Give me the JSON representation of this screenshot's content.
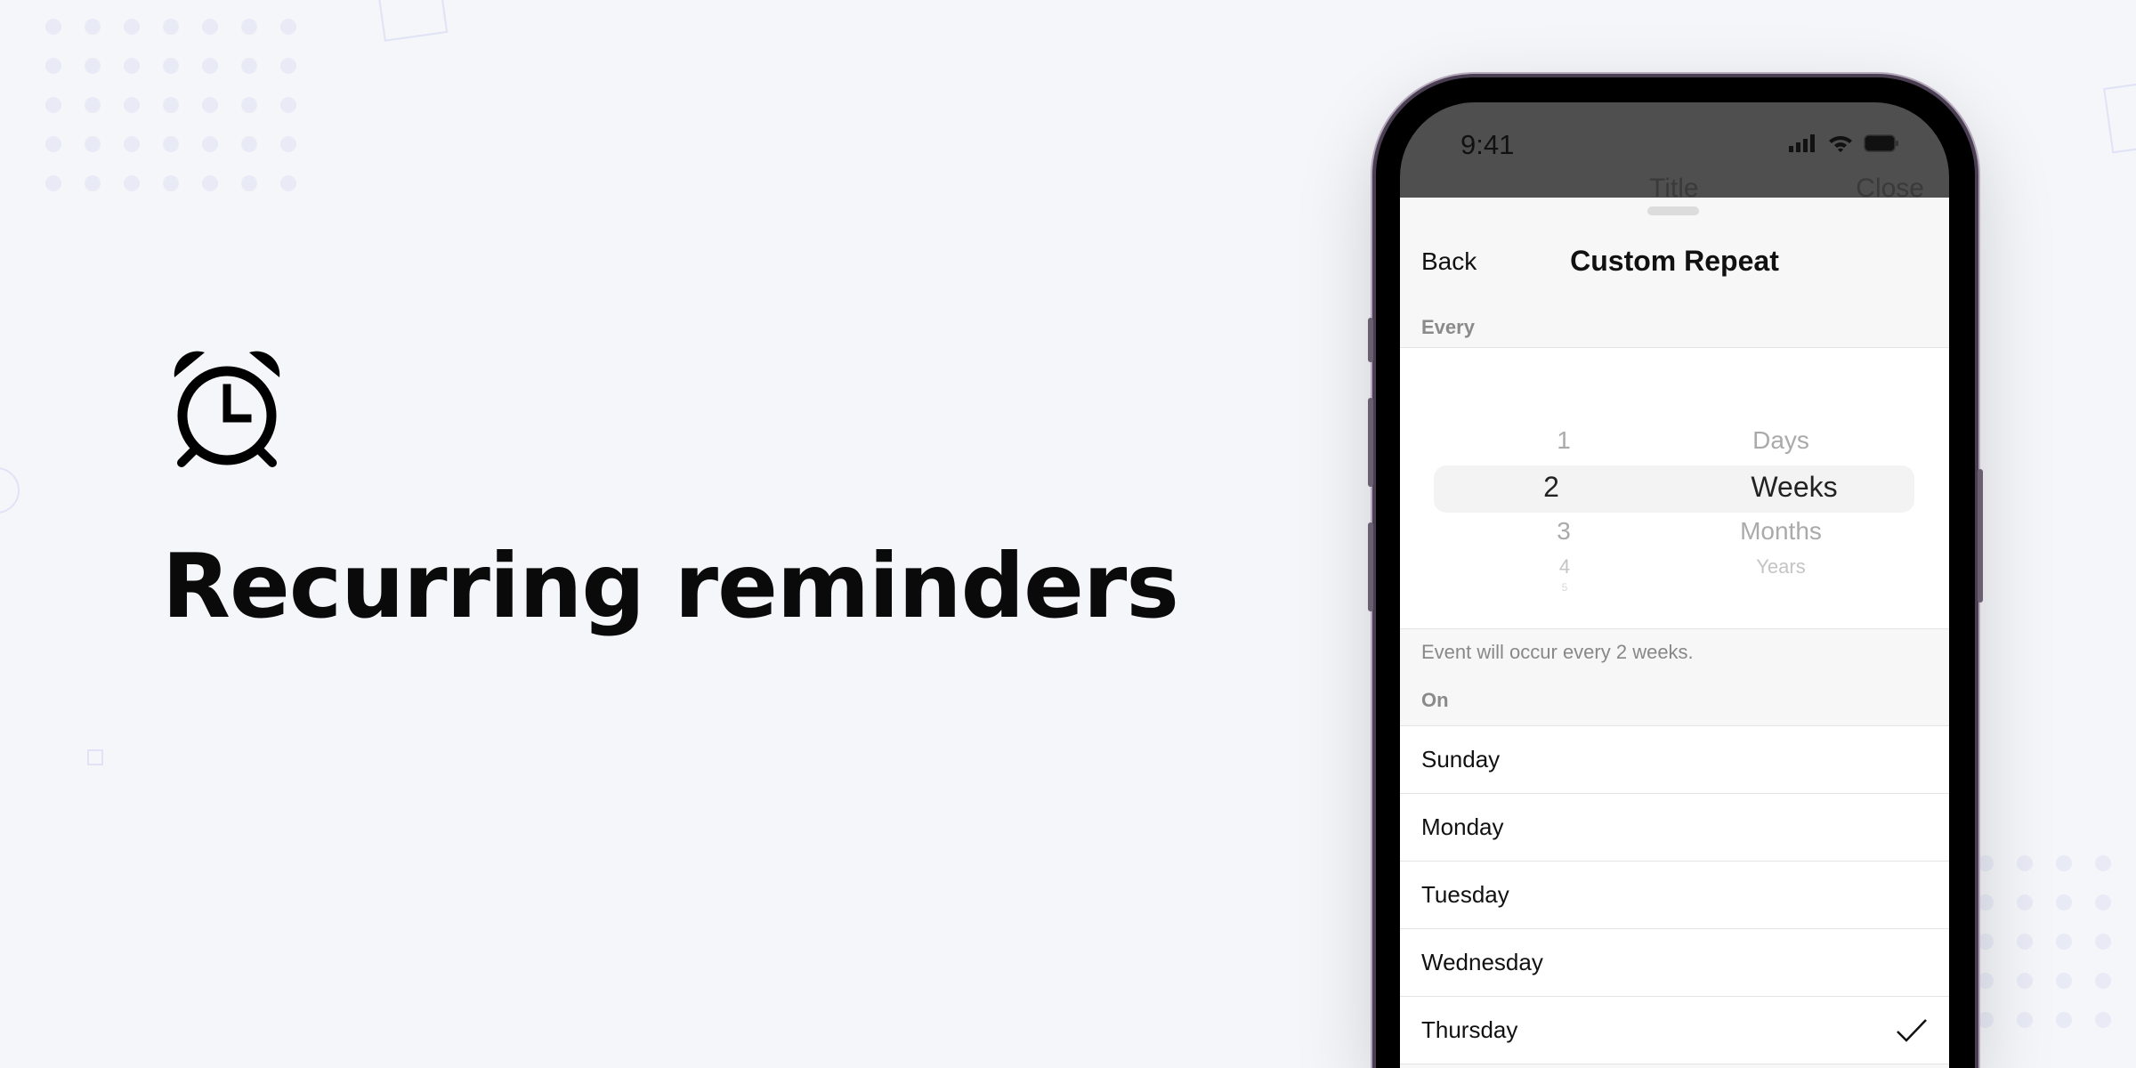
{
  "hero": {
    "title": "Recurring reminders",
    "icon": "alarm-clock-icon"
  },
  "phone": {
    "status_bar": {
      "time": "9:41",
      "icons": [
        "cellular-signal-icon",
        "wifi-icon",
        "battery-icon"
      ]
    },
    "behind": {
      "title": "Title",
      "close": "Close"
    },
    "sheet": {
      "back_label": "Back",
      "title": "Custom Repeat",
      "every_label": "Every",
      "picker": {
        "numbers": [
          "1",
          "2",
          "3",
          "4",
          "5"
        ],
        "units": [
          "Days",
          "Weeks",
          "Months",
          "Years"
        ],
        "selected_number": "2",
        "selected_unit": "Weeks"
      },
      "summary": "Event will occur every 2 weeks.",
      "on_label": "On",
      "days": [
        {
          "label": "Sunday",
          "checked": false
        },
        {
          "label": "Monday",
          "checked": false
        },
        {
          "label": "Tuesday",
          "checked": false
        },
        {
          "label": "Wednesday",
          "checked": false
        },
        {
          "label": "Thursday",
          "checked": true
        }
      ]
    }
  }
}
